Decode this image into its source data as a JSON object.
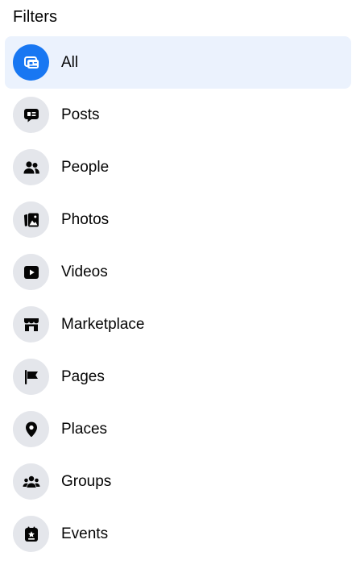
{
  "title": "Filters",
  "colors": {
    "active_bg": "#ebf2fd",
    "active_icon_bg": "#1877f2",
    "icon_bg": "#e4e6eb",
    "icon_fg": "#050505",
    "text": "#050505"
  },
  "filters": [
    {
      "label": "All",
      "icon": "all-results-icon",
      "active": true
    },
    {
      "label": "Posts",
      "icon": "posts-icon",
      "active": false
    },
    {
      "label": "People",
      "icon": "people-icon",
      "active": false
    },
    {
      "label": "Photos",
      "icon": "photos-icon",
      "active": false
    },
    {
      "label": "Videos",
      "icon": "videos-icon",
      "active": false
    },
    {
      "label": "Marketplace",
      "icon": "marketplace-icon",
      "active": false
    },
    {
      "label": "Pages",
      "icon": "pages-flag-icon",
      "active": false
    },
    {
      "label": "Places",
      "icon": "places-pin-icon",
      "active": false
    },
    {
      "label": "Groups",
      "icon": "groups-icon",
      "active": false
    },
    {
      "label": "Events",
      "icon": "events-icon",
      "active": false
    }
  ]
}
